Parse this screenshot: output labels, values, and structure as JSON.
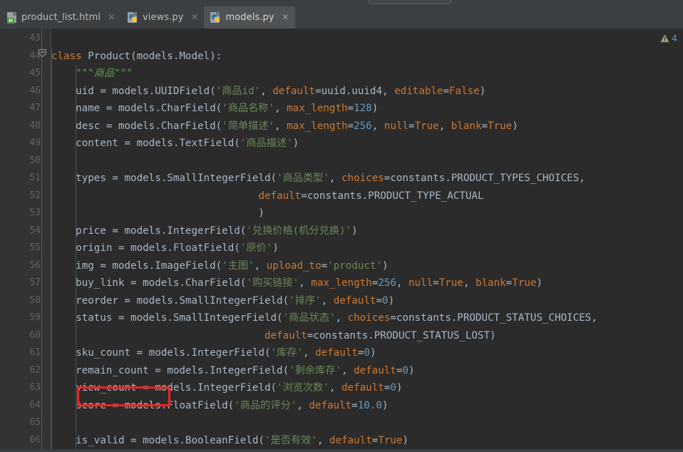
{
  "window": {
    "title": "models.py",
    "theme": "darcula"
  },
  "search_peek": {
    "name": "search-everywhere-field"
  },
  "tabs": [
    {
      "label": "product_list.html",
      "icon": "html-file-icon",
      "badge": "H",
      "active": false,
      "close": "×"
    },
    {
      "label": "views.py",
      "icon": "python-file-icon",
      "badge": "",
      "active": false,
      "close": "×"
    },
    {
      "label": "models.py",
      "icon": "python-file-icon",
      "badge": "",
      "active": true,
      "close": "×"
    }
  ],
  "inspection": {
    "icon": "warning-triangle-icon",
    "count": "4",
    "count_color": "#5394ec",
    "icon_color": "#a8a085"
  },
  "annotation": {
    "name": "red-highlight-box",
    "target_text": "remain_count",
    "color": "#f5231f",
    "line": 62
  },
  "editor": {
    "first_line": 43,
    "last_line": 66,
    "line_numbers": [
      43,
      44,
      45,
      46,
      47,
      48,
      49,
      50,
      51,
      52,
      53,
      54,
      55,
      56,
      57,
      58,
      59,
      60,
      61,
      62,
      63,
      64,
      65,
      66
    ],
    "colors": {
      "background": "#2b2b2b",
      "gutter": "#313335",
      "keyword": "#cc7832",
      "string": "#6a8759",
      "number": "#6897bb",
      "identifier": "#a9b7c6",
      "docstring": "#629755",
      "line_number": "#606366"
    },
    "lines": [
      {
        "n": 43,
        "tokens": []
      },
      {
        "n": 44,
        "tokens": [
          {
            "t": "class ",
            "c": "kw"
          },
          {
            "t": "Product(models.Model):",
            "c": "plain"
          }
        ]
      },
      {
        "n": 45,
        "tokens": [
          {
            "t": "    ",
            "c": "plain"
          },
          {
            "t": "\"\"\"商品\"\"\"",
            "c": "doc"
          }
        ]
      },
      {
        "n": 46,
        "tokens": [
          {
            "t": "    uid = models.UUIDField(",
            "c": "plain"
          },
          {
            "t": "'商品id'",
            "c": "str"
          },
          {
            "t": ", ",
            "c": "plain"
          },
          {
            "t": "default",
            "c": "kwarg"
          },
          {
            "t": "=uuid.uuid4, ",
            "c": "plain"
          },
          {
            "t": "editable",
            "c": "kwarg"
          },
          {
            "t": "=",
            "c": "plain"
          },
          {
            "t": "False",
            "c": "kw"
          },
          {
            "t": ")",
            "c": "plain"
          }
        ]
      },
      {
        "n": 47,
        "tokens": [
          {
            "t": "    name = models.CharField(",
            "c": "plain"
          },
          {
            "t": "'商品名称'",
            "c": "str"
          },
          {
            "t": ", ",
            "c": "plain"
          },
          {
            "t": "max_length",
            "c": "kwarg"
          },
          {
            "t": "=",
            "c": "plain"
          },
          {
            "t": "128",
            "c": "num"
          },
          {
            "t": ")",
            "c": "plain"
          }
        ]
      },
      {
        "n": 48,
        "tokens": [
          {
            "t": "    desc = models.CharField(",
            "c": "plain"
          },
          {
            "t": "'简单描述'",
            "c": "str"
          },
          {
            "t": ", ",
            "c": "plain"
          },
          {
            "t": "max_length",
            "c": "kwarg"
          },
          {
            "t": "=",
            "c": "plain"
          },
          {
            "t": "256",
            "c": "num"
          },
          {
            "t": ", ",
            "c": "plain"
          },
          {
            "t": "null",
            "c": "kwarg"
          },
          {
            "t": "=",
            "c": "plain"
          },
          {
            "t": "True",
            "c": "kw"
          },
          {
            "t": ", ",
            "c": "plain"
          },
          {
            "t": "blank",
            "c": "kwarg"
          },
          {
            "t": "=",
            "c": "plain"
          },
          {
            "t": "True",
            "c": "kw"
          },
          {
            "t": ")",
            "c": "plain"
          }
        ]
      },
      {
        "n": 49,
        "tokens": [
          {
            "t": "    content = models.TextField(",
            "c": "plain"
          },
          {
            "t": "'商品描述'",
            "c": "str"
          },
          {
            "t": ")",
            "c": "plain"
          }
        ]
      },
      {
        "n": 50,
        "tokens": []
      },
      {
        "n": 51,
        "tokens": [
          {
            "t": "    types = models.SmallIntegerField(",
            "c": "plain"
          },
          {
            "t": "'商品类型'",
            "c": "str"
          },
          {
            "t": ", ",
            "c": "plain"
          },
          {
            "t": "choices",
            "c": "kwarg"
          },
          {
            "t": "=constants.PRODUCT_TYPES_CHOICES,",
            "c": "plain"
          }
        ]
      },
      {
        "n": 52,
        "tokens": [
          {
            "t": "                                  ",
            "c": "plain"
          },
          {
            "t": "default",
            "c": "kwarg"
          },
          {
            "t": "=constants.PRODUCT_TYPE_ACTUAL",
            "c": "plain"
          }
        ]
      },
      {
        "n": 53,
        "tokens": [
          {
            "t": "                                  )",
            "c": "plain"
          }
        ]
      },
      {
        "n": 54,
        "tokens": [
          {
            "t": "    price = models.IntegerField(",
            "c": "plain"
          },
          {
            "t": "'兑换价格(机分兑换)'",
            "c": "str"
          },
          {
            "t": ")",
            "c": "plain"
          }
        ]
      },
      {
        "n": 55,
        "tokens": [
          {
            "t": "    origin = models.FloatField(",
            "c": "plain"
          },
          {
            "t": "'原价'",
            "c": "str"
          },
          {
            "t": ")",
            "c": "plain"
          }
        ]
      },
      {
        "n": 56,
        "tokens": [
          {
            "t": "    img = models.ImageField(",
            "c": "plain"
          },
          {
            "t": "'主图'",
            "c": "str"
          },
          {
            "t": ", ",
            "c": "plain"
          },
          {
            "t": "upload_to",
            "c": "kwarg"
          },
          {
            "t": "=",
            "c": "plain"
          },
          {
            "t": "'product'",
            "c": "str"
          },
          {
            "t": ")",
            "c": "plain"
          }
        ]
      },
      {
        "n": 57,
        "tokens": [
          {
            "t": "    buy_link = models.CharField(",
            "c": "plain"
          },
          {
            "t": "'购买链接'",
            "c": "str"
          },
          {
            "t": ", ",
            "c": "plain"
          },
          {
            "t": "max_length",
            "c": "kwarg"
          },
          {
            "t": "=",
            "c": "plain"
          },
          {
            "t": "256",
            "c": "num"
          },
          {
            "t": ", ",
            "c": "plain"
          },
          {
            "t": "null",
            "c": "kwarg"
          },
          {
            "t": "=",
            "c": "plain"
          },
          {
            "t": "True",
            "c": "kw"
          },
          {
            "t": ", ",
            "c": "plain"
          },
          {
            "t": "blank",
            "c": "kwarg"
          },
          {
            "t": "=",
            "c": "plain"
          },
          {
            "t": "True",
            "c": "kw"
          },
          {
            "t": ")",
            "c": "plain"
          }
        ]
      },
      {
        "n": 58,
        "tokens": [
          {
            "t": "    reorder = models.SmallIntegerField(",
            "c": "plain"
          },
          {
            "t": "'排序'",
            "c": "str"
          },
          {
            "t": ", ",
            "c": "plain"
          },
          {
            "t": "default",
            "c": "kwarg"
          },
          {
            "t": "=",
            "c": "plain"
          },
          {
            "t": "0",
            "c": "num"
          },
          {
            "t": ")",
            "c": "plain"
          }
        ]
      },
      {
        "n": 59,
        "tokens": [
          {
            "t": "    status = models.SmallIntegerField(",
            "c": "plain"
          },
          {
            "t": "'商品状态'",
            "c": "str"
          },
          {
            "t": ", ",
            "c": "plain"
          },
          {
            "t": "choices",
            "c": "kwarg"
          },
          {
            "t": "=constants.PRODUCT_STATUS_CHOICES,",
            "c": "plain"
          }
        ]
      },
      {
        "n": 60,
        "tokens": [
          {
            "t": "                                   ",
            "c": "plain"
          },
          {
            "t": "default",
            "c": "kwarg"
          },
          {
            "t": "=constants.PRODUCT_STATUS_LOST)",
            "c": "plain"
          }
        ]
      },
      {
        "n": 61,
        "tokens": [
          {
            "t": "    sku_count = models.IntegerField(",
            "c": "plain"
          },
          {
            "t": "'库存'",
            "c": "str"
          },
          {
            "t": ", ",
            "c": "plain"
          },
          {
            "t": "default",
            "c": "kwarg"
          },
          {
            "t": "=",
            "c": "plain"
          },
          {
            "t": "0",
            "c": "num"
          },
          {
            "t": ")",
            "c": "plain"
          }
        ]
      },
      {
        "n": 62,
        "tokens": [
          {
            "t": "    remain_count = models.IntegerField(",
            "c": "plain"
          },
          {
            "t": "'剩余库存'",
            "c": "str"
          },
          {
            "t": ", ",
            "c": "plain"
          },
          {
            "t": "default",
            "c": "kwarg"
          },
          {
            "t": "=",
            "c": "plain"
          },
          {
            "t": "0",
            "c": "num"
          },
          {
            "t": ")",
            "c": "plain"
          }
        ]
      },
      {
        "n": 63,
        "tokens": [
          {
            "t": "    view_count = models.IntegerField(",
            "c": "plain"
          },
          {
            "t": "'浏览次数'",
            "c": "str"
          },
          {
            "t": ", ",
            "c": "plain"
          },
          {
            "t": "default",
            "c": "kwarg"
          },
          {
            "t": "=",
            "c": "plain"
          },
          {
            "t": "0",
            "c": "num"
          },
          {
            "t": ")",
            "c": "plain"
          }
        ]
      },
      {
        "n": 64,
        "tokens": [
          {
            "t": "    score = models.FloatField(",
            "c": "plain"
          },
          {
            "t": "'商品的评分'",
            "c": "str"
          },
          {
            "t": ", ",
            "c": "plain"
          },
          {
            "t": "default",
            "c": "kwarg"
          },
          {
            "t": "=",
            "c": "plain"
          },
          {
            "t": "10.0",
            "c": "num"
          },
          {
            "t": ")",
            "c": "plain"
          }
        ]
      },
      {
        "n": 65,
        "tokens": []
      },
      {
        "n": 66,
        "tokens": [
          {
            "t": "    is_valid = models.BooleanField(",
            "c": "plain"
          },
          {
            "t": "'是否有效'",
            "c": "str"
          },
          {
            "t": ", ",
            "c": "plain"
          },
          {
            "t": "default",
            "c": "kwarg"
          },
          {
            "t": "=",
            "c": "plain"
          },
          {
            "t": "True",
            "c": "kw"
          },
          {
            "t": ")",
            "c": "plain"
          }
        ]
      }
    ]
  }
}
